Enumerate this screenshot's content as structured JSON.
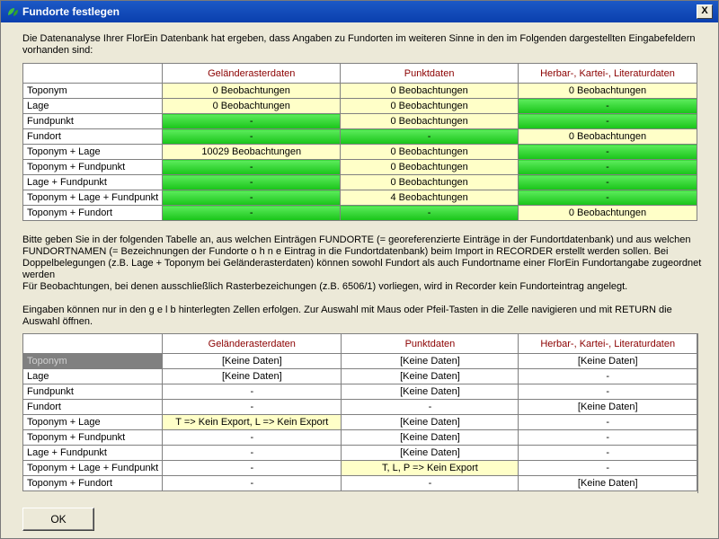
{
  "window": {
    "title": "Fundorte festlegen",
    "close_label": "X"
  },
  "intro_text": "Die Datenanalyse Ihrer FlorEin Datenbank hat ergeben, dass Angaben zu Fundorten im weiteren Sinne in den im Folgenden dargestellten Eingabefeldern vorhanden sind:",
  "table1": {
    "columns": [
      "Geländerasterdaten",
      "Punktdaten",
      "Herbar-, Kartei-, Literaturdaten"
    ],
    "rows": [
      {
        "label": "Toponym",
        "cells": [
          {
            "v": "0 Beobachtungen",
            "s": "y"
          },
          {
            "v": "0 Beobachtungen",
            "s": "y"
          },
          {
            "v": "0 Beobachtungen",
            "s": "y"
          }
        ]
      },
      {
        "label": "Lage",
        "cells": [
          {
            "v": "0 Beobachtungen",
            "s": "y"
          },
          {
            "v": "0 Beobachtungen",
            "s": "y"
          },
          {
            "v": "-",
            "s": "g"
          }
        ]
      },
      {
        "label": "Fundpunkt",
        "cells": [
          {
            "v": "-",
            "s": "g"
          },
          {
            "v": "0 Beobachtungen",
            "s": "y"
          },
          {
            "v": "-",
            "s": "g"
          }
        ]
      },
      {
        "label": "Fundort",
        "cells": [
          {
            "v": "-",
            "s": "g"
          },
          {
            "v": "-",
            "s": "g"
          },
          {
            "v": "0 Beobachtungen",
            "s": "y"
          }
        ]
      },
      {
        "label": "Toponym + Lage",
        "cells": [
          {
            "v": "10029 Beobachtungen",
            "s": "y"
          },
          {
            "v": "0 Beobachtungen",
            "s": "y"
          },
          {
            "v": "-",
            "s": "g"
          }
        ]
      },
      {
        "label": "Toponym + Fundpunkt",
        "cells": [
          {
            "v": "-",
            "s": "g"
          },
          {
            "v": "0 Beobachtungen",
            "s": "y"
          },
          {
            "v": "-",
            "s": "g"
          }
        ]
      },
      {
        "label": "Lage + Fundpunkt",
        "cells": [
          {
            "v": "-",
            "s": "g"
          },
          {
            "v": "0 Beobachtungen",
            "s": "y"
          },
          {
            "v": "-",
            "s": "g"
          }
        ]
      },
      {
        "label": "Toponym + Lage + Fundpunkt",
        "cells": [
          {
            "v": "-",
            "s": "g"
          },
          {
            "v": "4 Beobachtungen",
            "s": "y"
          },
          {
            "v": "-",
            "s": "g"
          }
        ]
      },
      {
        "label": "Toponym + Fundort",
        "cells": [
          {
            "v": "-",
            "s": "g"
          },
          {
            "v": "-",
            "s": "g"
          },
          {
            "v": "0 Beobachtungen",
            "s": "y"
          }
        ]
      }
    ]
  },
  "instructions": [
    "Bitte geben Sie in der folgenden Tabelle an, aus welchen Einträgen FUNDORTE (= georeferenzierte Einträge in der Fundortdatenbank) und aus welchen FUNDORTNAMEN (= Bezeichnungen der Fundorte  o h n e  Eintrag in die Fundortdatenbank) beim Import in RECORDER erstellt werden sollen. Bei Doppelbelegungen (z.B. Lage + Toponym bei Geländerasterdaten) können sowohl Fundort als auch Fundortname einer FlorEin Fundortangabe zugeordnet werden",
    "Für Beobachtungen, bei denen ausschließlich Rasterbezeichungen (z.B. 6506/1) vorliegen, wird in Recorder kein Fundorteintrag angelegt.",
    "Eingaben können nur in den  g e l b  hinterlegten Zellen erfolgen. Zur Auswahl mit Maus oder Pfeil-Tasten in die Zelle navigieren und mit RETURN die Auswahl öffnen."
  ],
  "table2": {
    "columns": [
      "Geländerasterdaten",
      "Punktdaten",
      "Herbar-, Kartei-, Literaturdaten"
    ],
    "rows": [
      {
        "label": "Toponym",
        "selected": true,
        "cells": [
          {
            "v": "[Keine Daten]",
            "s": "w"
          },
          {
            "v": "[Keine Daten]",
            "s": "w"
          },
          {
            "v": "[Keine Daten]",
            "s": "w"
          }
        ]
      },
      {
        "label": "Lage",
        "cells": [
          {
            "v": "[Keine Daten]",
            "s": "w"
          },
          {
            "v": "[Keine Daten]",
            "s": "w"
          },
          {
            "v": "-",
            "s": "w"
          }
        ]
      },
      {
        "label": "Fundpunkt",
        "cells": [
          {
            "v": "-",
            "s": "w"
          },
          {
            "v": "[Keine Daten]",
            "s": "w"
          },
          {
            "v": "-",
            "s": "w"
          }
        ]
      },
      {
        "label": "Fundort",
        "cells": [
          {
            "v": "-",
            "s": "w"
          },
          {
            "v": "-",
            "s": "w"
          },
          {
            "v": "[Keine Daten]",
            "s": "w"
          }
        ]
      },
      {
        "label": "Toponym + Lage",
        "cells": [
          {
            "v": "T => Kein Export, L => Kein Export",
            "s": "y"
          },
          {
            "v": "[Keine Daten]",
            "s": "w"
          },
          {
            "v": "-",
            "s": "w"
          }
        ]
      },
      {
        "label": "Toponym + Fundpunkt",
        "cells": [
          {
            "v": "-",
            "s": "w"
          },
          {
            "v": "[Keine Daten]",
            "s": "w"
          },
          {
            "v": "-",
            "s": "w"
          }
        ]
      },
      {
        "label": "Lage + Fundpunkt",
        "cells": [
          {
            "v": "-",
            "s": "w"
          },
          {
            "v": "[Keine Daten]",
            "s": "w"
          },
          {
            "v": "-",
            "s": "w"
          }
        ]
      },
      {
        "label": "Toponym + Lage + Fundpunkt",
        "cells": [
          {
            "v": "-",
            "s": "w"
          },
          {
            "v": "T, L, P => Kein Export",
            "s": "y"
          },
          {
            "v": "-",
            "s": "w"
          }
        ]
      },
      {
        "label": "Toponym + Fundort",
        "cells": [
          {
            "v": "-",
            "s": "w"
          },
          {
            "v": "-",
            "s": "w"
          },
          {
            "v": "[Keine Daten]",
            "s": "w"
          }
        ]
      }
    ]
  },
  "ok_label": "OK",
  "colors": {
    "title_bar": "#0a3fae",
    "header_text": "#8b0000",
    "editable_yellow": "#ffffc8",
    "status_green": "#18c418"
  }
}
